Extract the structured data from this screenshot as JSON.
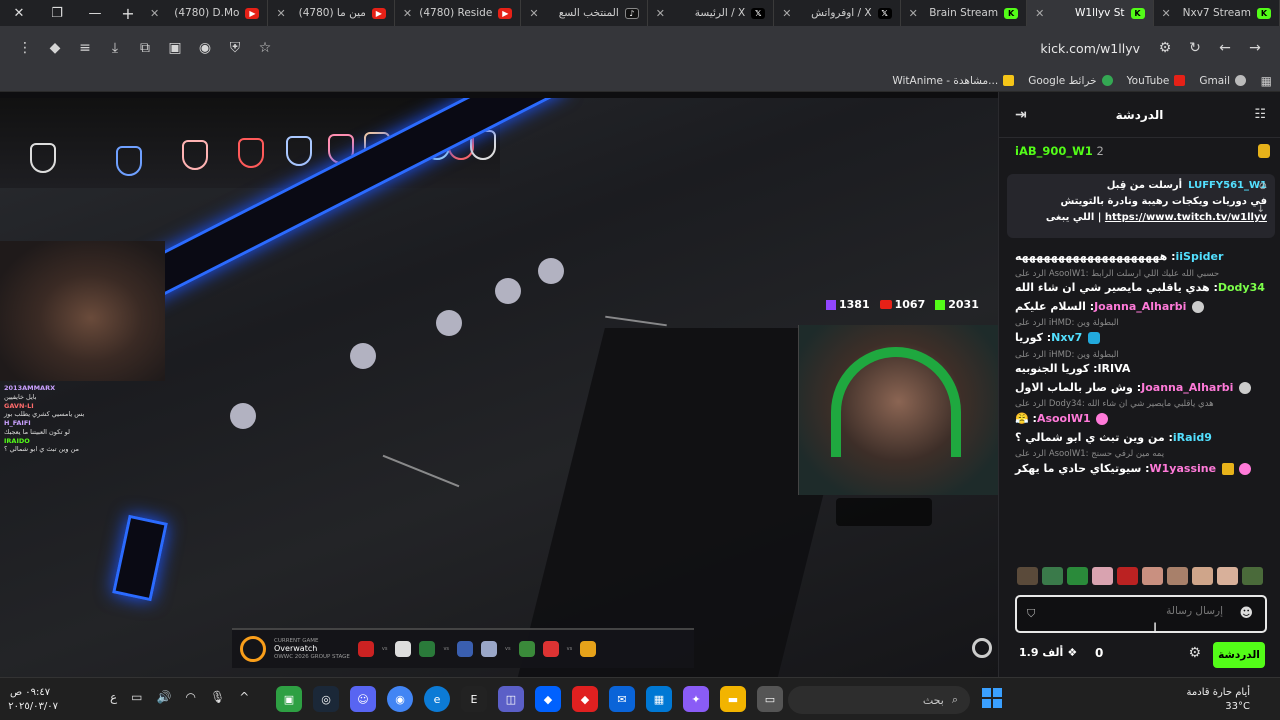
{
  "browser": {
    "tabs": [
      {
        "title": "(4780) D.Mo",
        "icon": "youtube-icon",
        "color": "#e62117"
      },
      {
        "title": "(4780) مين ما",
        "icon": "youtube-icon",
        "color": "#e62117"
      },
      {
        "title": "(4780) Reside",
        "icon": "youtube-icon",
        "color": "#e62117"
      },
      {
        "title": "المنتخب السع",
        "icon": "tiktok-icon",
        "color": "#111111"
      },
      {
        "title": "الرئيسة / X",
        "icon": "x-icon",
        "color": "#000000"
      },
      {
        "title": "اوفرواتش / X",
        "icon": "x-icon",
        "color": "#000000"
      },
      {
        "title": "Brain Stream",
        "icon": "kick-icon",
        "color": "#53fc18"
      },
      {
        "title": "W1llyv St",
        "icon": "kick-icon",
        "color": "#53fc18",
        "active": true
      },
      {
        "title": "Nxv7 Stream",
        "icon": "kick-icon",
        "color": "#53fc18"
      }
    ],
    "url": "kick.com/w1llyv",
    "bookmarks": [
      {
        "label": "Gmail",
        "icon": "google-icon",
        "color": "#cccccc"
      },
      {
        "label": "YouTube",
        "icon": "youtube-icon",
        "color": "#e62117"
      },
      {
        "label": "Google خرائط",
        "icon": "maps-icon",
        "color": "#34a853"
      },
      {
        "label": "WitAnime - مشاهدة...",
        "icon": "witanime-icon",
        "color": "#f5c518"
      }
    ]
  },
  "stream": {
    "viewer_counts": {
      "twitch": "1381",
      "youtube": "1067",
      "kick": "2031"
    },
    "overlay_chat": [
      {
        "user": "2013AMMARX",
        "text": ""
      },
      {
        "user": "",
        "text": "بايل خايفيين"
      },
      {
        "user": "GAVN-LI",
        "text": ""
      },
      {
        "user": "",
        "text": "بس يامسيي كشري يطلب بوز"
      },
      {
        "user": "H_FAIFI",
        "text": ""
      },
      {
        "user": "",
        "text": "لو تكون العبيتنا ما يعجبك"
      },
      {
        "user": "IRAIDO",
        "text": ""
      },
      {
        "user": "",
        "text": "من وين تبث ي ابو شمالي ؟"
      }
    ],
    "scoreboard": {
      "label": "CURRENT GAME",
      "game": "Overwatch",
      "event": "OWWC 2026 GROUP STAGE"
    }
  },
  "chat": {
    "title": "الدردشة",
    "leader": {
      "name": "iAB_900_W1",
      "rank": "2"
    },
    "pinned": {
      "user": "LUFFY561_W1",
      "sent_by": "أرسلت من قِبل",
      "text": "في دوريات ويكجات رهيبة ونادرة بالتويتش",
      "link": "https://www.twitch.tv/w1llyv",
      "suffix": "اللي يبغى |"
    },
    "messages": [
      {
        "reply": "",
        "user": "iiSpider",
        "user_color": "#53e0ff",
        "text": "ههههههههههههههههههههه"
      },
      {
        "reply": "حسبي الله عليك اللي ارسلت الرابط :AsoolW1 الرد على",
        "user": "Dody34",
        "user_color": "#7cff4a",
        "text": "هدي ياقلبي مايصير شي ان شاء الله"
      },
      {
        "reply": "",
        "user": "Joanna_Alharbi",
        "user_color": "#ff7ad9",
        "text": "السلام عليكم"
      },
      {
        "reply": "البطولة وين :iHMD الرد على",
        "user": "Nxv7",
        "user_color": "#53e0ff",
        "text": "كوريا"
      },
      {
        "reply": "البطولة وين :iHMD الرد على",
        "user": "IRIVA",
        "user_color": "#ffffff",
        "text": "كوريا الجنوبيه"
      },
      {
        "reply": "",
        "user": "Joanna_Alharbi",
        "user_color": "#ff7ad9",
        "text": "وش صار بالماب الاول"
      },
      {
        "reply": "هدي ياقلبي مايصير شي ان شاء الله :Dody34 الرد على",
        "user": "AsoolW1",
        "user_color": "#ff7ad9",
        "text": "😤"
      },
      {
        "reply": "",
        "user": "iRaid9",
        "user_color": "#53e0ff",
        "text": "من وين تبث ي ابو شمالي ؟"
      },
      {
        "reply": "يمه مين لرفي حسنج :AsoolW1 الرد على",
        "user": "W1yassine",
        "user_color": "#ff7ad9",
        "text": "سيوتيكاي حادي ما يهكر"
      }
    ],
    "input_placeholder": "إرسال رسالة",
    "send_label": "الدردشة",
    "footer_count": "0",
    "kicks": "1.9 ألف"
  },
  "taskbar": {
    "time": "٠٩:٤٧ ص",
    "date": "٢٠٢٥/٠٣/٠٧",
    "lang": "ع",
    "search_placeholder": "بحث",
    "weather_text": "أيام حارة قادمة",
    "weather_temp": "33°C"
  }
}
